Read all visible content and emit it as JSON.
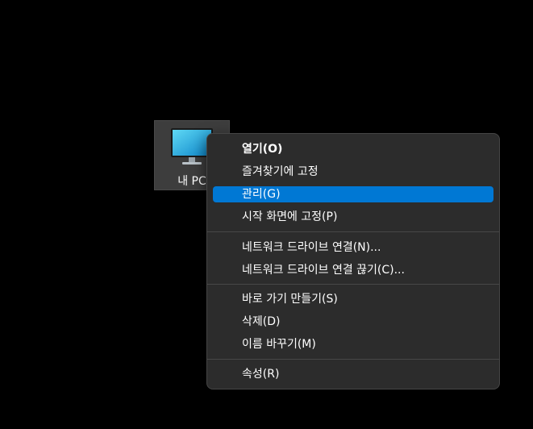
{
  "desktop": {
    "icon": {
      "icon_name": "monitor-icon",
      "label": "내 PC"
    }
  },
  "context_menu": {
    "highlight_color": "#0078d4",
    "groups": [
      [
        {
          "label": "열기(O)",
          "bold": true
        },
        {
          "label": "즐겨찾기에 고정"
        },
        {
          "label": "관리(G)",
          "highlighted": true
        },
        {
          "label": "시작 화면에 고정(P)"
        }
      ],
      [
        {
          "label": "네트워크 드라이브 연결(N)..."
        },
        {
          "label": "네트워크 드라이브 연결 끊기(C)..."
        }
      ],
      [
        {
          "label": "바로 가기 만들기(S)"
        },
        {
          "label": "삭제(D)"
        },
        {
          "label": "이름 바꾸기(M)"
        }
      ],
      [
        {
          "label": "속성(R)"
        }
      ]
    ]
  }
}
